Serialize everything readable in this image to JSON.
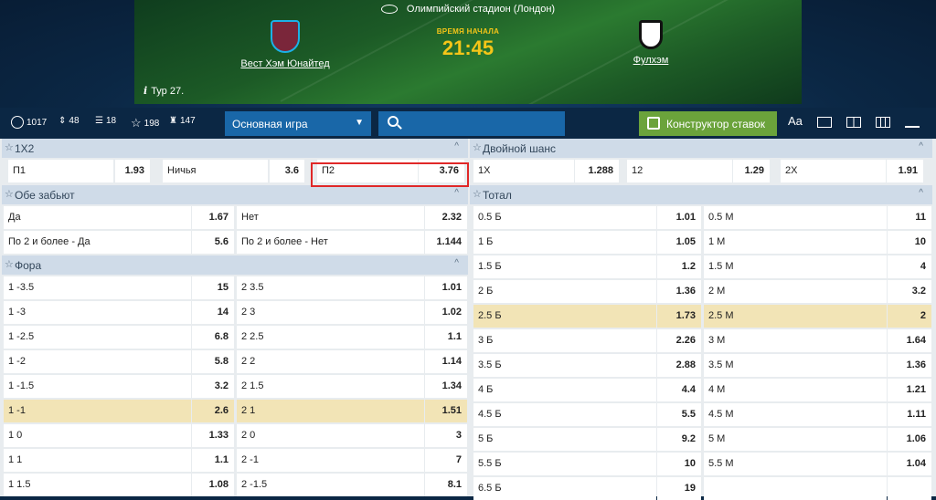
{
  "match": {
    "stadium": "Олимпийский стадион (Лондон)",
    "home": "Вест Хэм Юнайтед",
    "away": "Фулхэм",
    "time_label": "ВРЕМЯ НАЧАЛА",
    "time": "21:45",
    "tour": "Тур 27.",
    "tour_icon": "i"
  },
  "toolbar": {
    "counts": [
      "1017",
      "48",
      "18",
      "198",
      "147"
    ],
    "select": "Основная игра",
    "builder": "Конструктор ставок",
    "font_label": "Aa"
  },
  "colors": {
    "accent": "#1967a8",
    "builder": "#6ba33b",
    "header": "#cfdbe8",
    "highlight": "#f2e4b6",
    "selected_border": "#e02828"
  },
  "market_1x2": {
    "title": "1X2",
    "cells": [
      [
        "П1",
        "1.93"
      ],
      [
        "Ничья",
        "3.6"
      ],
      [
        "П2",
        "3.76"
      ]
    ]
  },
  "double_chance": {
    "title": "Двойной шанс",
    "cells": [
      [
        "1X",
        "1.288"
      ],
      [
        "12",
        "1.29"
      ],
      [
        "2X",
        "1.91"
      ]
    ]
  },
  "both_score": {
    "title": "Обе забьют",
    "rows": [
      [
        "Да",
        "1.67",
        "Нет",
        "2.32"
      ],
      [
        "По 2 и более - Да",
        "5.6",
        "По 2 и более - Нет",
        "1.144"
      ]
    ]
  },
  "handicap": {
    "title": "Фора",
    "rows": [
      [
        "1 -3.5",
        "15",
        "2 3.5",
        "1.01"
      ],
      [
        "1 -3",
        "14",
        "2 3",
        "1.02"
      ],
      [
        "1 -2.5",
        "6.8",
        "2 2.5",
        "1.1"
      ],
      [
        "1 -2",
        "5.8",
        "2 2",
        "1.14"
      ],
      [
        "1 -1.5",
        "3.2",
        "2 1.5",
        "1.34"
      ],
      [
        "1 -1",
        "2.6",
        "2 1",
        "1.51"
      ],
      [
        "1 0",
        "1.33",
        "2 0",
        "3"
      ],
      [
        "1 1",
        "1.1",
        "2 -1",
        "7"
      ],
      [
        "1 1.5",
        "1.08",
        "2 -1.5",
        "8.1"
      ]
    ]
  },
  "total": {
    "title": "Тотал",
    "rows": [
      [
        "0.5 Б",
        "1.01",
        "0.5 М",
        "11"
      ],
      [
        "1 Б",
        "1.05",
        "1 М",
        "10"
      ],
      [
        "1.5 Б",
        "1.2",
        "1.5 М",
        "4"
      ],
      [
        "2 Б",
        "1.36",
        "2 М",
        "3.2"
      ],
      [
        "2.5 Б",
        "1.73",
        "2.5 М",
        "2"
      ],
      [
        "3 Б",
        "2.26",
        "3 М",
        "1.64"
      ],
      [
        "3.5 Б",
        "2.88",
        "3.5 М",
        "1.36"
      ],
      [
        "4 Б",
        "4.4",
        "4 М",
        "1.21"
      ],
      [
        "4.5 Б",
        "5.5",
        "4.5 М",
        "1.11"
      ],
      [
        "5 Б",
        "9.2",
        "5 М",
        "1.06"
      ],
      [
        "5.5 Б",
        "10",
        "5.5 М",
        "1.04"
      ],
      [
        "6.5 Б",
        "19",
        "",
        ""
      ]
    ]
  }
}
